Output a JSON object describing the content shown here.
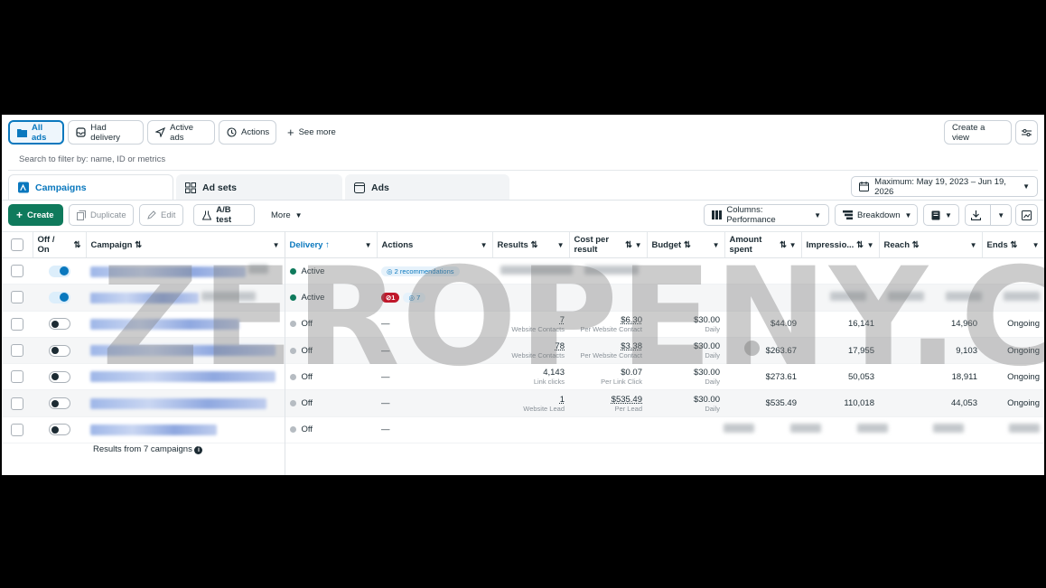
{
  "filter_tabs": {
    "all_ads": "All ads",
    "had_delivery": "Had delivery",
    "active_ads": "Active ads",
    "actions": "Actions",
    "see_more": "See more",
    "create_view": "Create a view"
  },
  "search": {
    "placeholder": "Search to filter by: name, ID or metrics"
  },
  "level_tabs": {
    "campaigns": "Campaigns",
    "ad_sets": "Ad sets",
    "ads": "Ads"
  },
  "date_range": "Maximum: May 19, 2023 – Jun 19, 2026",
  "toolbar": {
    "create": "Create",
    "duplicate": "Duplicate",
    "edit": "Edit",
    "ab_test": "A/B test",
    "more": "More",
    "columns": "Columns: Performance",
    "breakdown": "Breakdown"
  },
  "columns": {
    "off_on_1": "Off /",
    "off_on_2": "On",
    "campaign": "Campaign",
    "delivery": "Delivery",
    "actions": "Actions",
    "results": "Results",
    "cost_1": "Cost per",
    "cost_2": "result",
    "budget": "Budget",
    "amount_1": "Amount",
    "amount_2": "spent",
    "impressions": "Impressio...",
    "reach": "Reach",
    "ends": "Ends"
  },
  "rows": [
    {
      "delivery": "Active",
      "recommendations": "2 recommendations"
    },
    {
      "delivery": "Active",
      "error_count": "1",
      "rec_count": "7"
    },
    {
      "delivery": "Off",
      "actions": "—",
      "results": "7",
      "results_label": "Website Contacts",
      "cost": "$6.30",
      "cost_label": "Per Website Contact",
      "budget": "$30.00",
      "budget_label": "Daily",
      "spent": "$44.09",
      "impressions": "16,141",
      "reach": "14,960",
      "ends": "Ongoing"
    },
    {
      "delivery": "Off",
      "actions": "—",
      "results": "78",
      "results_label": "Website Contacts",
      "cost": "$3.38",
      "cost_label": "Per Website Contact",
      "budget": "$30.00",
      "budget_label": "Daily",
      "spent": "$263.67",
      "impressions": "17,955",
      "reach": "9,103",
      "ends": "Ongoing"
    },
    {
      "delivery": "Off",
      "actions": "—",
      "results": "4,143",
      "results_label": "Link clicks",
      "cost": "$0.07",
      "cost_label": "Per Link Click",
      "budget": "$30.00",
      "budget_label": "Daily",
      "spent": "$273.61",
      "impressions": "50,053",
      "reach": "18,911",
      "ends": "Ongoing"
    },
    {
      "delivery": "Off",
      "actions": "—",
      "results": "1",
      "results_label": "Website Lead",
      "cost": "$535.49",
      "cost_label": "Per Lead",
      "budget": "$30.00",
      "budget_label": "Daily",
      "spent": "$535.49",
      "impressions": "110,018",
      "reach": "44,053",
      "ends": "Ongoing"
    },
    {
      "delivery": "Off",
      "actions": "—"
    }
  ],
  "footer": "Results from 7 campaigns",
  "watermark": "ZEROPENY.CO",
  "colors": {
    "accent": "#0a78be",
    "primary_button": "#0f7a5c",
    "active_dot": "#0f7a5c",
    "error": "#c0182b"
  }
}
